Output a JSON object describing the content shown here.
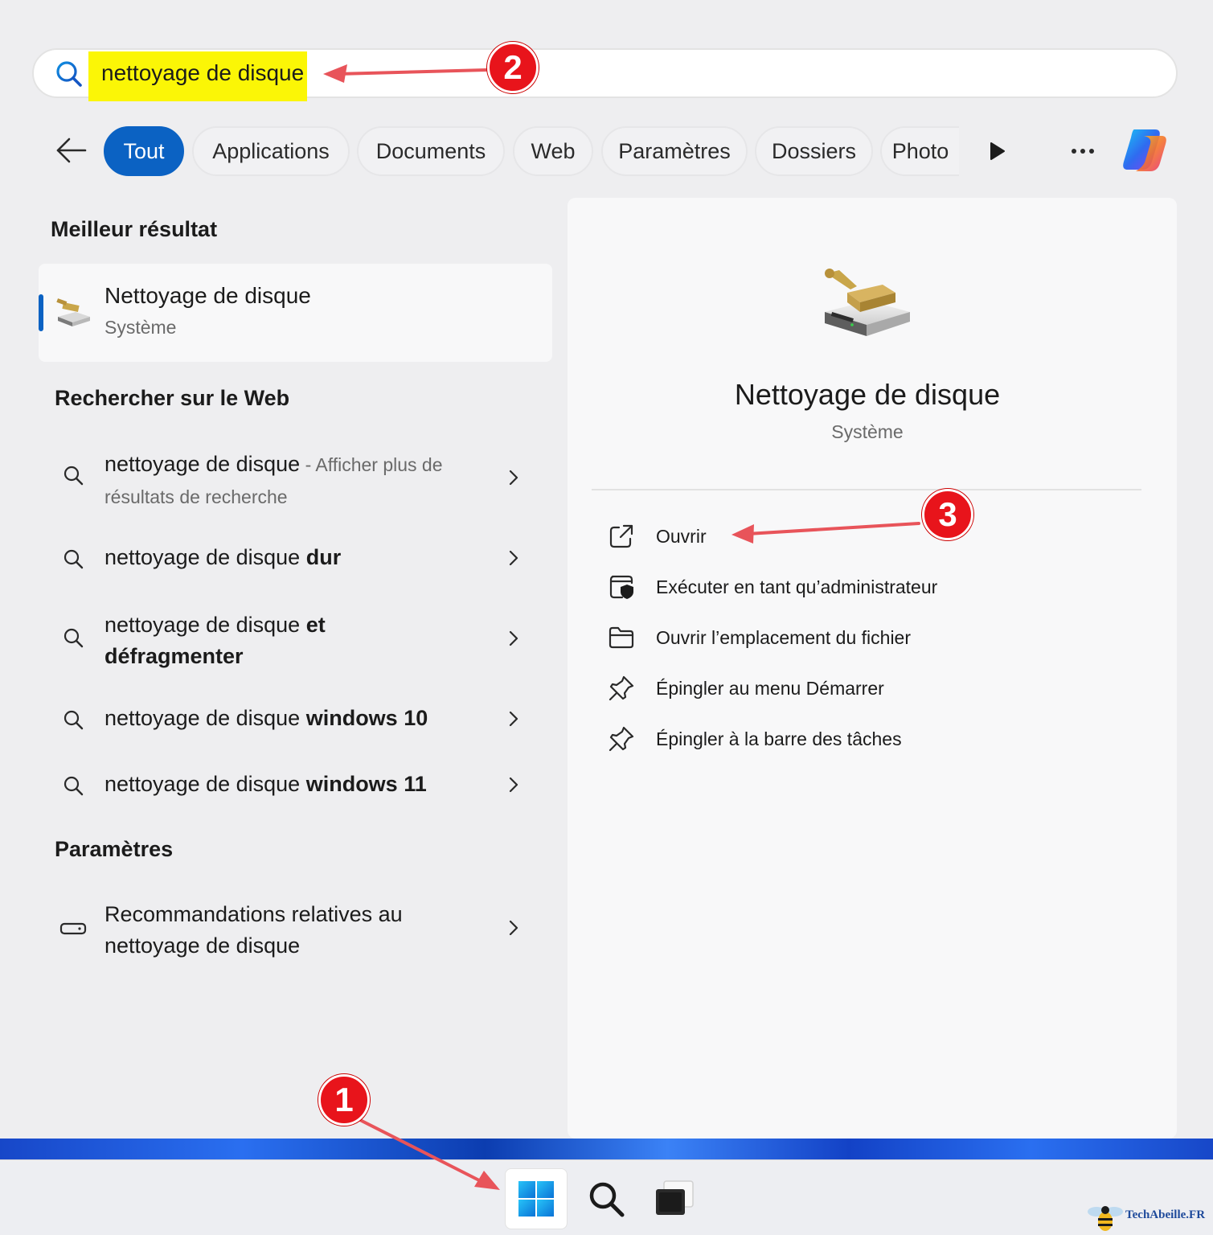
{
  "search": {
    "query": "nettoyage de disque"
  },
  "filters": {
    "chips": [
      "Tout",
      "Applications",
      "Documents",
      "Web",
      "Paramètres",
      "Dossiers",
      "Photo"
    ],
    "active": "Tout"
  },
  "best_match": {
    "heading": "Meilleur résultat",
    "title": "Nettoyage de disque",
    "subtitle": "Système"
  },
  "web": {
    "heading": "Rechercher sur le Web",
    "items": [
      {
        "normal": "nettoyage de disque",
        "muted": " - Afficher plus de résultats de recherche",
        "bold": ""
      },
      {
        "normal": "nettoyage de disque ",
        "muted": "",
        "bold": "dur"
      },
      {
        "normal": "nettoyage de disque ",
        "muted": "",
        "bold": "et défragmenter"
      },
      {
        "normal": "nettoyage de disque ",
        "muted": "",
        "bold": "windows 10"
      },
      {
        "normal": "nettoyage de disque ",
        "muted": "",
        "bold": "windows 11"
      }
    ]
  },
  "settings": {
    "heading": "Paramètres",
    "items": [
      {
        "label": "Recommandations relatives au nettoyage de disque"
      }
    ]
  },
  "detail": {
    "title": "Nettoyage de disque",
    "subtitle": "Système",
    "actions": [
      {
        "label": "Ouvrir",
        "icon": "open-external-icon"
      },
      {
        "label": "Exécuter en tant qu’administrateur",
        "icon": "run-as-admin-icon"
      },
      {
        "label": "Ouvrir l’emplacement du fichier",
        "icon": "folder-icon"
      },
      {
        "label": "Épingler au menu Démarrer",
        "icon": "pin-icon"
      },
      {
        "label": "Épingler à la barre des tâches",
        "icon": "pin-icon"
      }
    ]
  },
  "annotations": [
    "1",
    "2",
    "3"
  ],
  "watermark": {
    "text": "TechAbeille.FR"
  },
  "colors": {
    "accent": "#0b62c3",
    "highlight": "#fbf606",
    "annotation": "#e8141b"
  }
}
